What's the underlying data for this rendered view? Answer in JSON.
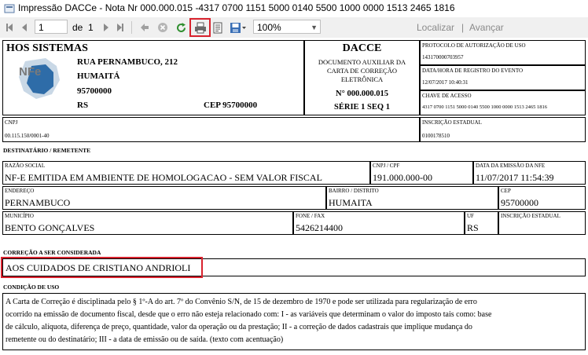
{
  "window": {
    "title": "Impressão DACCe - Nota Nr 000.000.015 -4317 0700 1151 5000 0140 5500 1000 0000 1513 2465 1816"
  },
  "toolbar": {
    "page_current": "1",
    "page_of": "de",
    "page_total": "1",
    "zoom": "100%",
    "find_label": "Localizar",
    "next_label": "Avançar"
  },
  "emitter": {
    "name": "HOS SISTEMAS",
    "street": "RUA PERNAMBUCO, 212",
    "city": "HUMAITÁ",
    "zip": "95700000",
    "state": "RS",
    "cep_line": "CEP 95700000"
  },
  "dacce": {
    "title": "DACCE",
    "subtitle": "DOCUMENTO AUXILIAR DA CARTA DE CORREÇÃO ELETRÔNICA",
    "number": "N° 000.000.015",
    "series": "SÉRIE 1 SEQ 1"
  },
  "protocol": {
    "label": "PROTOCOLO DE AUTORIZAÇÃO DE USO",
    "value": "143170000703957",
    "datetime_label": "DATA/HORA DE REGISTRO DO EVENTO",
    "datetime_value": "12/07/2017 10:40:31",
    "key_label": "CHAVE DE ACESSO",
    "key_value": "4317 0700 1151 5000 0140 5500 1000 0000 1513 2465 1816"
  },
  "cnpj_row": {
    "cnpj_label": "CNPJ",
    "cnpj_value": "00.115.150/0001-40",
    "ie_label": "INSCRIÇÃO ESTADUAL",
    "ie_value": "0100178510"
  },
  "recipient": {
    "section_title": "DESTINATÁRIO / REMETENTE",
    "name_label": "RAZÃO SOCIAL",
    "name_value": "NF-E EMITIDA EM AMBIENTE DE HOMOLOGACAO - SEM VALOR FISCAL",
    "cnpj_label": "CNPJ / CPF",
    "cnpj_value": "191.000.000-00",
    "date_label": "DATA DA EMISSÃO DA NFe",
    "date_value": "11/07/2017 11:54:39",
    "address_label": "ENDEREÇO",
    "address_value": "PERNAMBUCO",
    "district_label": "BAIRRO / DISTRITO",
    "district_value": "HUMAITA",
    "cep_label": "CEP",
    "cep_value": "95700000",
    "city_label": "MUNICÍPIO",
    "city_value": "BENTO GONÇALVES",
    "phone_label": "FONE / FAX",
    "phone_value": "5426214400",
    "uf_label": "UF",
    "uf_value": "RS",
    "ie_label": "INSCRIÇÃO ESTADUAL",
    "ie_value": ""
  },
  "correction": {
    "section_title": "CORREÇÃO A SER CONSIDERADA",
    "text": "AOS CUIDADOS DE CRISTIANO ANDRIOLI"
  },
  "conditions": {
    "section_title": "CONDIÇÃO DE USO",
    "lines": [
      "A Carta de Correção é disciplinada pelo § 1º-A do art. 7º do Convênio S/N, de 15 de dezembro de 1970 e pode ser utilizada para regularização de erro",
      "ocorrido na emissão de documento fiscal, desde que o erro não esteja relacionado com: I - as variáveis que determinam o valor do imposto tais como: base",
      "de cálculo, alíquota, diferença de preço, quantidade, valor da operação ou da prestação; II - a correção de dados cadastrais que implique mudança do",
      "remetente ou do destinatário; III - a data de emissão ou de saída. (texto com acentuação)"
    ]
  },
  "logo": {
    "text": "NFe"
  },
  "icons": {
    "first": "first-page-icon",
    "prev": "previous-page-icon",
    "next": "next-page-icon",
    "last": "last-page-icon",
    "back": "back-icon",
    "stop": "stop-icon",
    "refresh": "refresh-icon",
    "print": "print-icon",
    "layout": "page-layout-icon",
    "export": "export-icon"
  },
  "colors": {
    "highlight": "#d9232e",
    "toolbar_bg": "#f0f0f0"
  }
}
